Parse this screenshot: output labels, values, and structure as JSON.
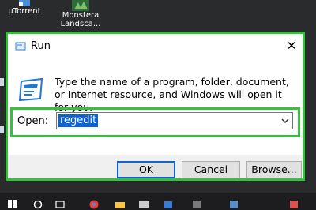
{
  "desktop": {
    "icons": [
      {
        "label_lines": [
          "µTorrent"
        ]
      },
      {
        "label_lines": [
          "Monstera",
          "Landsca..."
        ]
      }
    ]
  },
  "dialog": {
    "title": "Run",
    "close_glyph": "✕",
    "description": "Type the name of a program, folder, document, or Internet resource, and Windows will open it for you.",
    "open_label": "Open:",
    "open_value": "regedit",
    "buttons": {
      "ok": "OK",
      "cancel": "Cancel",
      "browse": "Browse..."
    }
  },
  "colors": {
    "highlight": "#35c23a",
    "selection": "#0a64d2"
  },
  "taskbar": {
    "icons": [
      "windows-start-icon",
      "cortana-icon",
      "task-view-icon",
      "chrome-icon",
      "file-explorer-icon",
      "mail-icon",
      "store-icon",
      "app-icon",
      "app-icon",
      "media-icon"
    ]
  }
}
